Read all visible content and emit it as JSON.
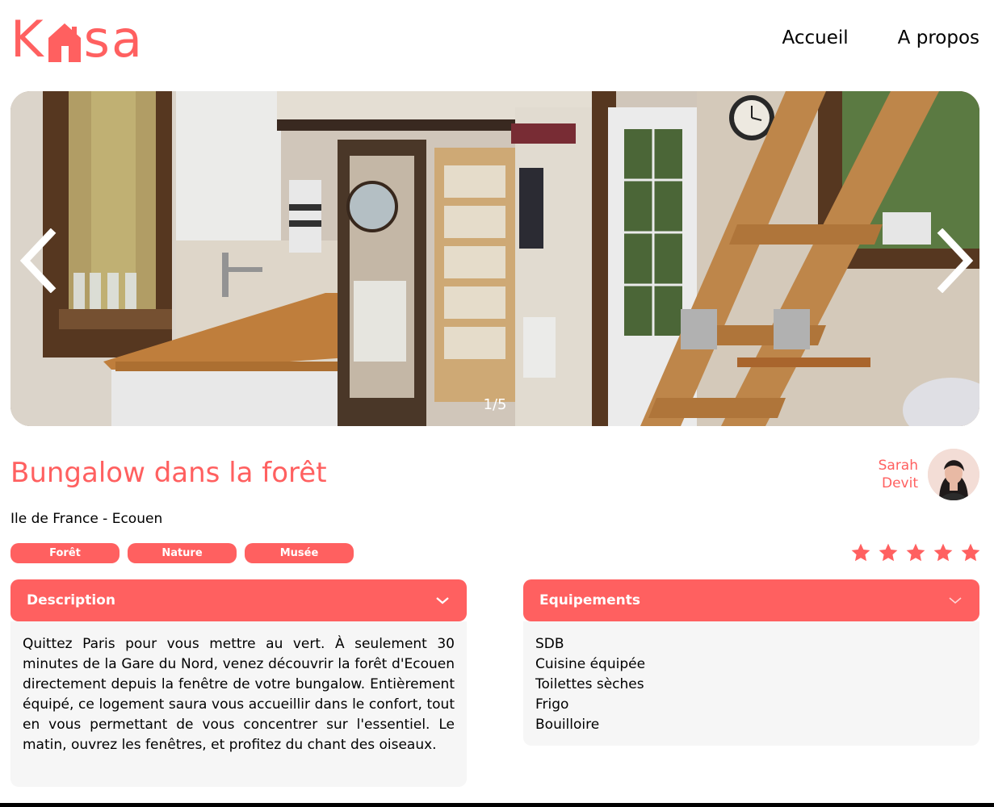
{
  "brand": {
    "logo_left": "K",
    "logo_right": "sa",
    "accent_color": "#ff6060"
  },
  "nav": {
    "items": [
      {
        "label": "Accueil"
      },
      {
        "label": "A propos"
      }
    ]
  },
  "carousel": {
    "counter": "1/5",
    "prev_icon": "chevron-left-icon",
    "next_icon": "chevron-right-icon"
  },
  "listing": {
    "title": "Bungalow dans la forêt",
    "location": "Ile de France - Ecouen",
    "tags": [
      "Forêt",
      "Nature",
      "Musée"
    ],
    "rating": 5,
    "rating_max": 5
  },
  "host": {
    "first_name": "Sarah",
    "last_name": "Devit"
  },
  "description": {
    "heading": "Description",
    "text": "Quittez Paris pour vous mettre au vert. À seulement 30 minutes de la Gare du Nord, venez découvrir la forêt d'Ecouen directement depuis la fenêtre de votre bungalow. Entièrement équipé, ce logement saura vous accueillir dans le confort, tout en vous permettant de vous concentrer sur l'essentiel. Le matin, ouvrez les fenêtres, et profitez du chant des oiseaux."
  },
  "equipments": {
    "heading": "Equipements",
    "items": [
      "SDB",
      "Cuisine équipée",
      "Toilettes sèches",
      "Frigo",
      "Bouilloire"
    ]
  }
}
